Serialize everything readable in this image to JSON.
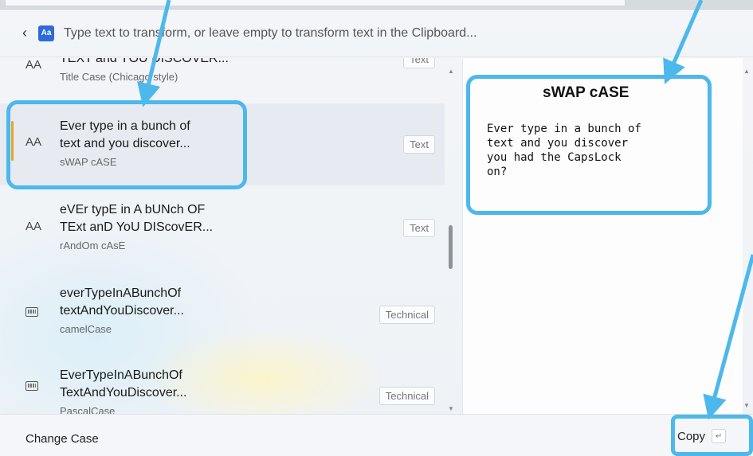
{
  "search": {
    "placeholder": "Type text to transform, or leave empty to transform text in the Clipboard..."
  },
  "app_icon_label": "Aa",
  "list": {
    "items": [
      {
        "title_line1": "TEXT and YOU DISCOVER...",
        "subtitle": "Title Case (Chicago style)",
        "tag": "Text",
        "icon": "text-size-icon"
      },
      {
        "title_line1": "Ever type in a bunch of",
        "title_line2": "text and you discover...",
        "subtitle": "sWAP cASE",
        "tag": "Text",
        "icon": "text-size-icon"
      },
      {
        "title_line1": "eVEr typE in A bUNch OF",
        "title_line2": "TExt anD YoU DIScovER...",
        "subtitle": "rAndOm cAsE",
        "tag": "Text",
        "icon": "text-size-icon"
      },
      {
        "title_line1": "everTypeInABunchOf",
        "title_line2": "textAndYouDiscover...",
        "subtitle": "camelCase",
        "tag": "Technical",
        "icon": "keyboard-icon"
      },
      {
        "title_line1": "EverTypeInABunchOf",
        "title_line2": "TextAndYouDiscover...",
        "subtitle": "PascalCase",
        "tag": "Technical",
        "icon": "keyboard-icon"
      }
    ]
  },
  "preview": {
    "title": "sWAP cASE",
    "body": "Ever type in a bunch of\ntext and you discover\nyou had the CapsLock\non?"
  },
  "footer": {
    "label": "Change Case",
    "copy_label": "Copy",
    "enter_glyph": "↵"
  },
  "colors": {
    "annotation": "#4db8ec",
    "selection_accent": "#e6a822",
    "app_icon": "#2f6bd8"
  }
}
